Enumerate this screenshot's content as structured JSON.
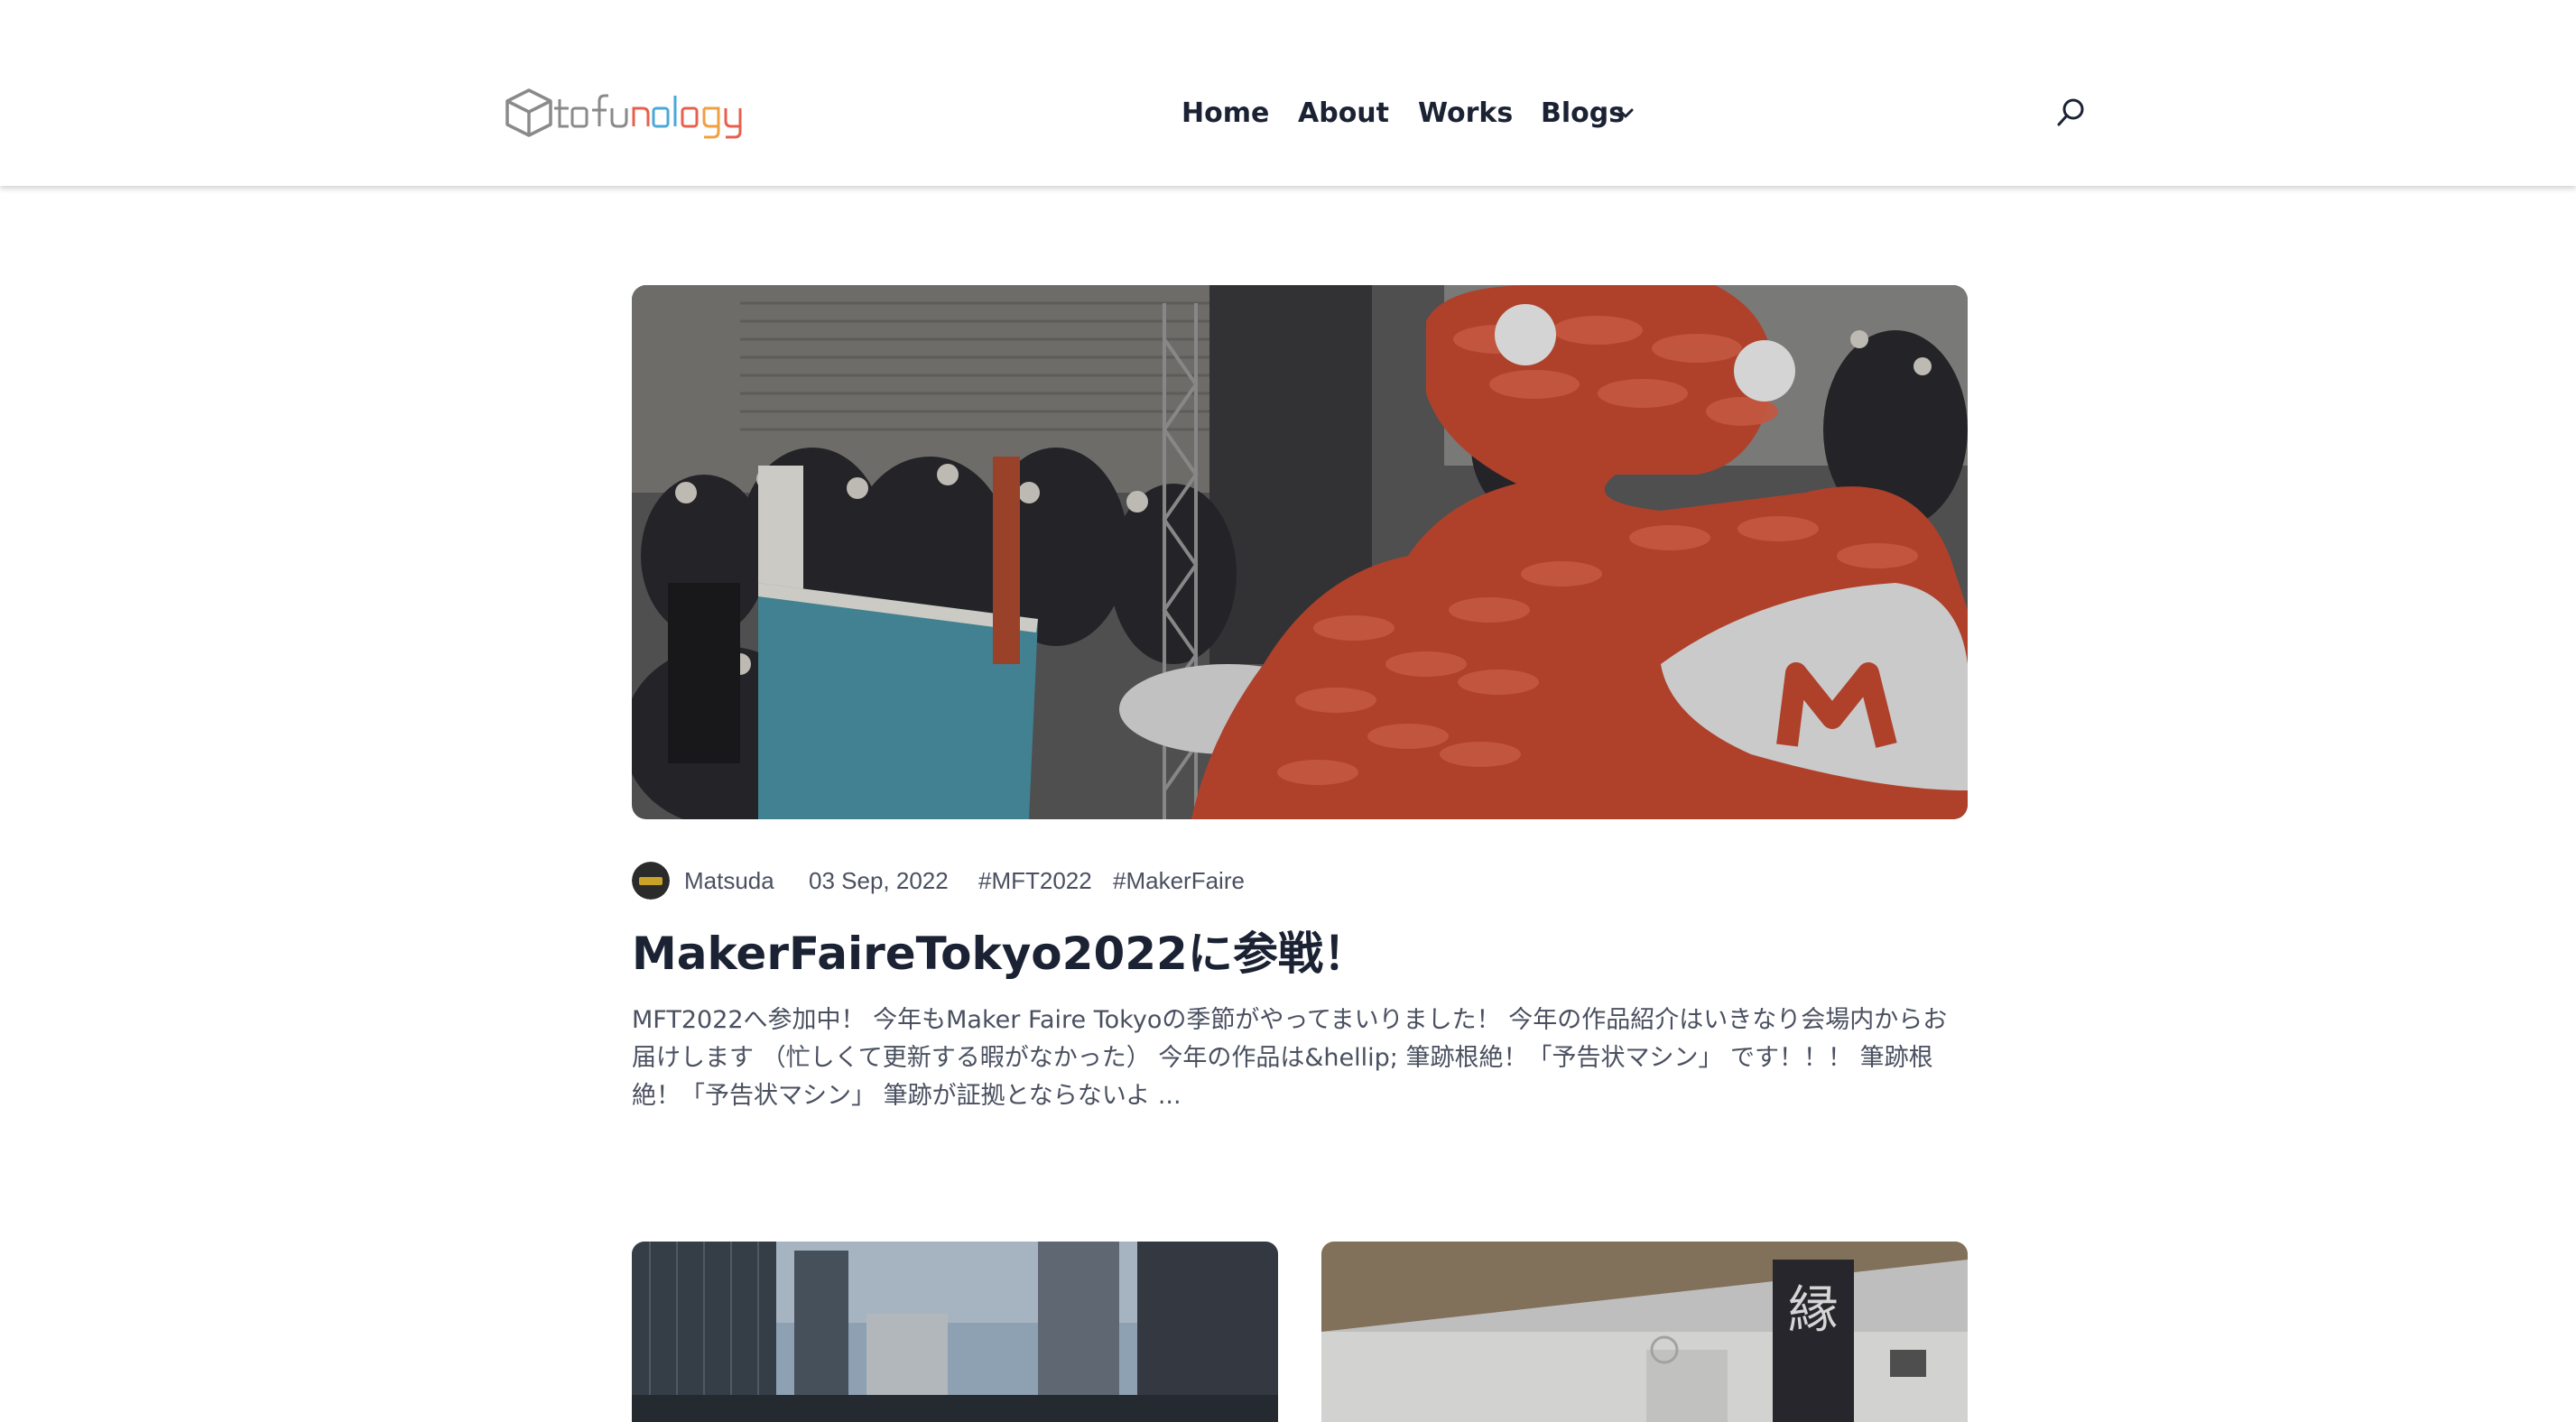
{
  "header": {
    "logo_text": "tofunology",
    "nav": [
      {
        "label": "Home"
      },
      {
        "label": "About"
      },
      {
        "label": "Works"
      },
      {
        "label": "Blogs"
      }
    ],
    "search_icon": "search-icon",
    "blogs_dropdown_icon": "chevron-down-icon"
  },
  "featured": {
    "image_alt": "Maker Faire Tokyo 2022",
    "author": "Matsuda",
    "date": "03 Sep, 2022",
    "tags": [
      "#MFT2022",
      "#MakerFaire"
    ],
    "title": "MakerFaireTokyo2022に参戦！",
    "excerpt": "MFT2022へ参加中！ 今年もMaker Faire Tokyoの季節がやってまいりました！ 今年の作品紹介はいきなり会場内からお届けします （忙しくて更新する暇がなかった） 今年の作品は&hellip; 筆跡根絶！「予告状マシン」 です！！！ 筆跡根絶！「予告状マシン」 筆跡が証拠とならないよ ..."
  },
  "cards": [
    {
      "image_alt": "Tokyo Big Sight crowd"
    },
    {
      "image_alt": "Building with banner"
    }
  ],
  "colors": {
    "heading": "#1b2233",
    "body_text": "#4a5060",
    "logo_red": "#e8604c",
    "logo_blue": "#4aa8d8",
    "logo_orange": "#f0a040",
    "logo_gray": "#8a8a8a"
  }
}
